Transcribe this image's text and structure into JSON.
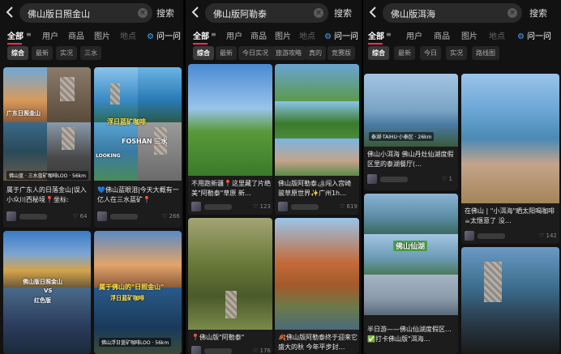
{
  "panels": [
    {
      "query": "佛山版日照金山",
      "search_btn": "搜索",
      "tabs": [
        "全部",
        "用户",
        "商品",
        "图片",
        "地点",
        "问一问"
      ],
      "chips": [
        "综合",
        "最新",
        "实况",
        "三水"
      ],
      "cards": [
        {
          "caption": "属于广东人的日落金山|误入小众川西秘境📍坐标:",
          "likes": "64",
          "loc_tag": "佛山蓝 · 三水蓝矿咖啡LOO · 56km",
          "overlay": "广东日照金山"
        },
        {
          "caption": "💙佛山蓝眼泪|今天大概有一亿人在三水蓝矿📍",
          "likes": "266",
          "overlay1": "浮日蓝矿咖啡",
          "overlay2": "FOSHAN 三水",
          "overlay3": "LOOKING"
        },
        {
          "overlay1": "佛山版日照金山",
          "overlay2": "VS",
          "overlay3": "红色版"
        },
        {
          "overlay1": "属于佛山的\"日照金山\"",
          "overlay2": "浮日蓝矿咖啡",
          "loc_tag": "佛山浮日蓝矿咖啡LOO · 56km"
        }
      ]
    },
    {
      "query": "佛山版阿勒泰",
      "search_btn": "搜索",
      "tabs": [
        "全部",
        "用户",
        "商品",
        "图片",
        "地点",
        "问一问"
      ],
      "chips": [
        "综合",
        "最新",
        "今日实况",
        "旅游攻略",
        "真的",
        "竞赛版"
      ],
      "cards": [
        {
          "caption": "不用跑新疆📍这里藏了片绝美\"阿勒泰\"草原 新…",
          "likes": "123"
        },
        {
          "caption": "佛山版阿勒泰🏕闯入宫崎骏草原世界✨广州1h…",
          "likes": "619"
        },
        {
          "caption": "📍佛山版\"阿勒泰\"",
          "likes": "176"
        },
        {
          "caption": "🍂佛山版阿勒泰终于迎来它盛大的秋 今年平步封…",
          "likes": ""
        }
      ]
    },
    {
      "query": "佛山版洱海",
      "search_btn": "搜索",
      "tabs": [
        "全部",
        "用户",
        "商品",
        "图片",
        "地点",
        "问一问"
      ],
      "chips": [
        "综合",
        "最新",
        "今日",
        "实况",
        "路线图"
      ],
      "cards": [
        {
          "caption": "佛山小洱海 佛山丹灶仙湖度假区里的泰湖餐厅(…",
          "likes": "1",
          "loc_tag": "泰湖·TAIHU·小泰区 · 26km"
        },
        {
          "caption": "在佛山 | \"小洱海\"晒太阳喝咖啡☕太惬意了 没…",
          "likes": "142"
        },
        {
          "caption": "半日游——佛山仙湖度假区…✅打卡佛山版\"洱海…",
          "likes": "",
          "overlay": "佛山仙湖"
        },
        {
          "caption": "",
          "likes": ""
        }
      ]
    }
  ]
}
